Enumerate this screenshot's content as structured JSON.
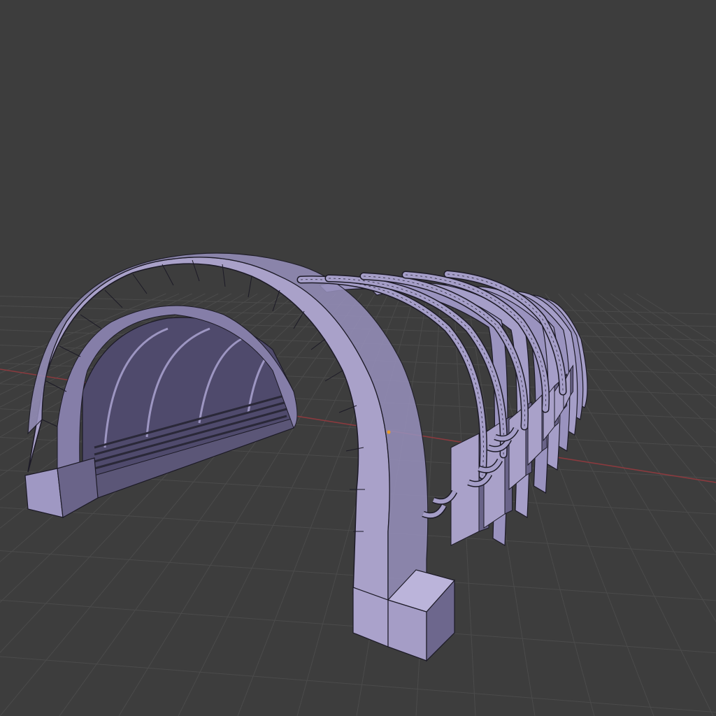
{
  "viewport": {
    "background_color": "#3d3d3d",
    "grid_color": "#4a4a4a",
    "x_axis_color": "#8a3a3e",
    "y_axis_color": "#5e7a2e",
    "mesh_face_color": "#a9a1c9",
    "mesh_shadow_color": "#5b5677",
    "mesh_dark_color": "#3e3a55",
    "wire_color": "#1c1a26",
    "origin_dot_color": "#e89a2c"
  },
  "scene": {
    "object": "tunnel-arch-mesh",
    "shading": "solid",
    "overlay": "wireframe"
  }
}
